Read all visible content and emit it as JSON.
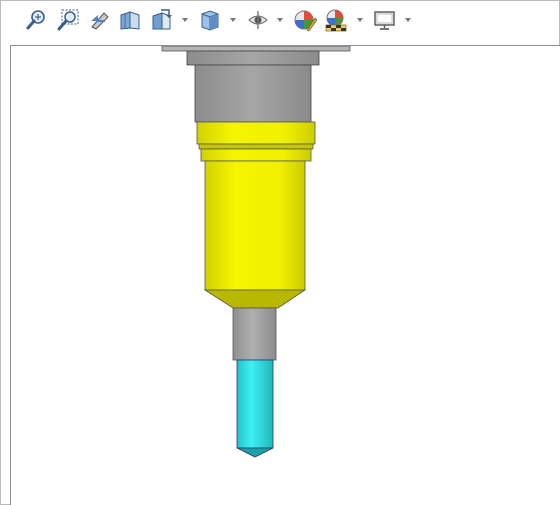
{
  "toolbar": {
    "icons": [
      {
        "name": "zoom-to-fit-icon"
      },
      {
        "name": "zoom-to-area-icon"
      },
      {
        "name": "previous-view-icon"
      },
      {
        "name": "section-view-icon"
      },
      {
        "name": "view-orientation-icon",
        "dropdown": true
      },
      {
        "name": "display-style-icon",
        "dropdown": true
      },
      {
        "name": "hide-show-items-icon",
        "dropdown": true
      },
      {
        "name": "edit-appearance-icon"
      },
      {
        "name": "apply-scene-icon",
        "dropdown": true
      },
      {
        "name": "view-settings-icon",
        "dropdown": true
      }
    ]
  },
  "model": {
    "name": "tool-holder-assembly",
    "colors": {
      "flange": "#a8a8a8",
      "body_gray": "#9a9a9a",
      "holder_yellow": "#f0f000",
      "holder_yellow_dark": "#c8c800",
      "shank_gray": "#a0a0a0",
      "tool_cyan": "#2fe6ea",
      "tool_cyan_dark": "#19a9ad"
    }
  }
}
